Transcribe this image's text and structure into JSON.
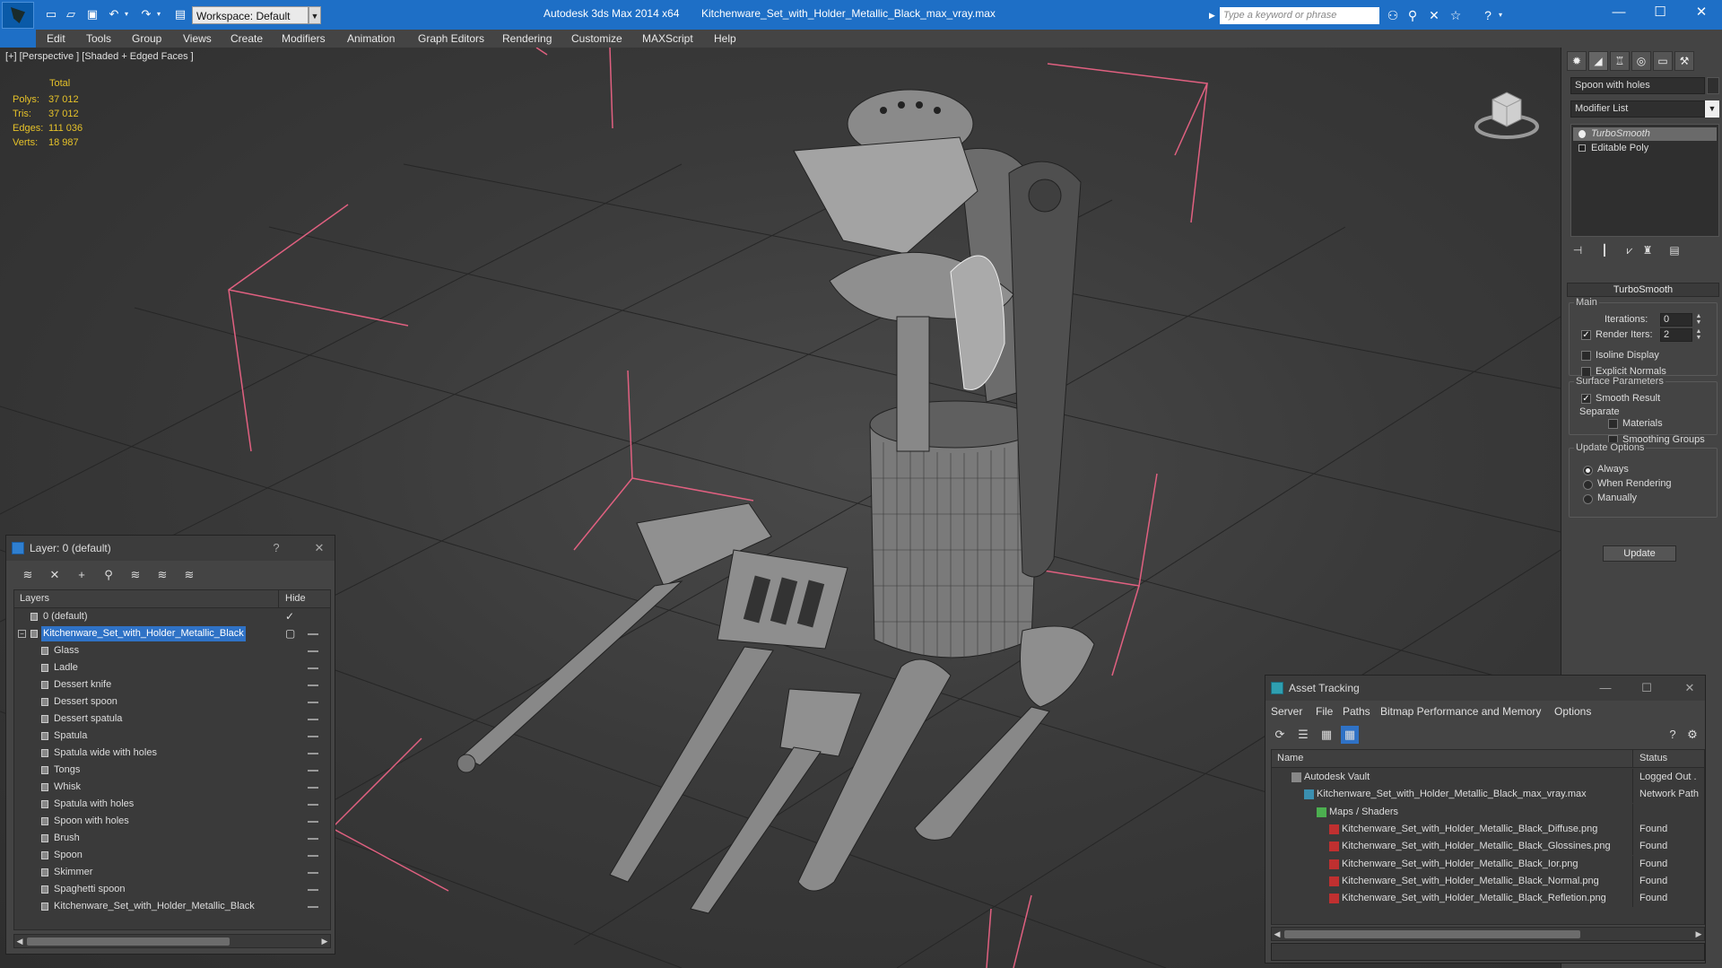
{
  "titlebar": {
    "workspace": "Workspace: Default",
    "app_title": "Autodesk 3ds Max  2014 x64",
    "file_title": "Kitchenware_Set_with_Holder_Metallic_Black_max_vray.max",
    "search_placeholder": "Type a keyword or phrase"
  },
  "menu": [
    "Edit",
    "Tools",
    "Group",
    "Views",
    "Create",
    "Modifiers",
    "Animation",
    "Graph Editors",
    "Rendering",
    "Customize",
    "MAXScript",
    "Help"
  ],
  "viewport": {
    "label": "[+] [Perspective ] [Shaded + Edged Faces ]",
    "stats_header": "Total",
    "stats": [
      {
        "label": "Polys:",
        "value": "37 012"
      },
      {
        "label": "Tris:",
        "value": "37 012"
      },
      {
        "label": "Edges:",
        "value": "111 036"
      },
      {
        "label": "Verts:",
        "value": "18 987"
      }
    ]
  },
  "command_panel": {
    "object_name": "Spoon with holes",
    "modifier_list": "Modifier List",
    "stack": [
      "TurboSmooth",
      "Editable Poly"
    ],
    "rollout_title": "TurboSmooth",
    "main_group": "Main",
    "iterations_label": "Iterations:",
    "iterations_value": "0",
    "render_iters_label": "Render Iters:",
    "render_iters_value": "2",
    "isoline_label": "Isoline Display",
    "explicit_normals_label": "Explicit Normals",
    "surface_group": "Surface Parameters",
    "smooth_result_label": "Smooth Result",
    "separate_label": "Separate",
    "materials_label": "Materials",
    "smoothing_groups_label": "Smoothing Groups",
    "update_group": "Update Options",
    "always_label": "Always",
    "when_rendering_label": "When Rendering",
    "manually_label": "Manually",
    "update_button": "Update"
  },
  "layer_dialog": {
    "title": "Layer: 0 (default)",
    "col_layers": "Layers",
    "col_hide": "Hide",
    "rows": [
      "0 (default)",
      "Kitchenware_Set_with_Holder_Metallic_Black",
      "Glass",
      "Ladle",
      "Dessert knife",
      "Dessert spoon",
      "Dessert spatula",
      "Spatula",
      "Spatula wide with holes",
      "Tongs",
      "Whisk",
      "Spatula with holes",
      "Spoon with holes",
      "Brush",
      "Spoon",
      "Skimmer",
      "Spaghetti spoon",
      "Kitchenware_Set_with_Holder_Metallic_Black"
    ]
  },
  "asset_dialog": {
    "title": "Asset Tracking",
    "menu": [
      "Server",
      "File",
      "Paths",
      "Bitmap Performance and Memory",
      "Options"
    ],
    "col_name": "Name",
    "col_status": "Status",
    "rows": [
      {
        "name": "Autodesk Vault",
        "status": "Logged Out ."
      },
      {
        "name": "Kitchenware_Set_with_Holder_Metallic_Black_max_vray.max",
        "status": "Network Path"
      },
      {
        "name": "Maps / Shaders",
        "status": ""
      },
      {
        "name": "Kitchenware_Set_with_Holder_Metallic_Black_Diffuse.png",
        "status": "Found"
      },
      {
        "name": "Kitchenware_Set_with_Holder_Metallic_Black_Glossines.png",
        "status": "Found"
      },
      {
        "name": "Kitchenware_Set_with_Holder_Metallic_Black_Ior.png",
        "status": "Found"
      },
      {
        "name": "Kitchenware_Set_with_Holder_Metallic_Black_Normal.png",
        "status": "Found"
      },
      {
        "name": "Kitchenware_Set_with_Holder_Metallic_Black_Refletion.png",
        "status": "Found"
      }
    ]
  },
  "colors": {
    "titlebar": "#1e6fc6",
    "selection": "#2f72c6",
    "stats_text": "#e6c229",
    "bbox_lines": "#e06080"
  }
}
